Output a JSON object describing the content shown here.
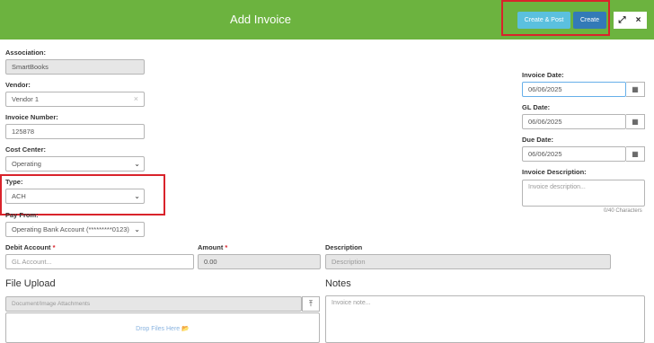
{
  "header": {
    "title": "Add Invoice",
    "create_post_label": "Create & Post",
    "create_label": "Create",
    "expand_glyph": "⤢",
    "close_glyph": "×"
  },
  "form": {
    "association": {
      "label": "Association:",
      "value": "SmartBooks"
    },
    "vendor": {
      "label": "Vendor:",
      "value": "Vendor 1",
      "clear_glyph": "×"
    },
    "invoice_number": {
      "label": "Invoice Number:",
      "value": "125878"
    },
    "cost_center": {
      "label": "Cost Center:",
      "value": "Operating"
    },
    "type": {
      "label": "Type:",
      "value": "ACH"
    },
    "pay_from": {
      "label": "Pay From:",
      "value": "Operating Bank Account (*********0123)"
    },
    "debit_account": {
      "label": "Debit Account",
      "required": "*",
      "placeholder": "GL Account..."
    },
    "amount": {
      "label": "Amount",
      "required": "*",
      "value": "0.00"
    },
    "description": {
      "label": "Description",
      "placeholder": "Description"
    },
    "invoice_date": {
      "label": "Invoice Date:",
      "value": "06/06/2025"
    },
    "gl_date": {
      "label": "GL Date:",
      "value": "06/06/2025"
    },
    "due_date": {
      "label": "Due Date:",
      "value": "06/06/2025"
    },
    "invoice_description": {
      "label": "Invoice Description:",
      "placeholder": "Invoice description...",
      "counter": "0/40 Characters"
    },
    "calendar_glyph": "▦",
    "chevron_glyph": "⌄"
  },
  "file_upload": {
    "title": "File Upload",
    "placeholder": "Document/Image Attachments",
    "upload_glyph": "⤒",
    "drop_label": "Drop Files Here 📂"
  },
  "notes": {
    "title": "Notes",
    "placeholder": "Invoice note..."
  },
  "colors": {
    "header": "#6cb33f",
    "create_post": "#5bc0de",
    "create": "#337ab7",
    "highlight": "#d9232b"
  }
}
